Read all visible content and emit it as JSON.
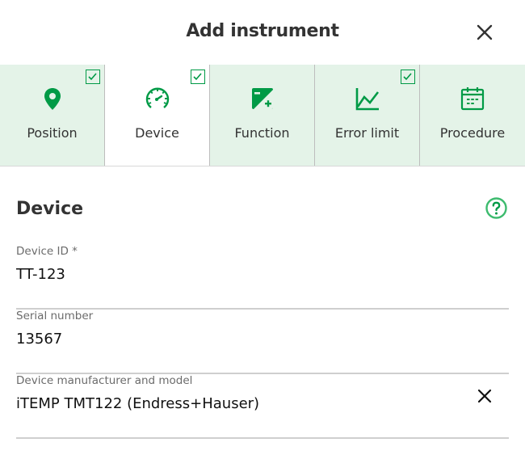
{
  "dialog": {
    "title": "Add instrument",
    "close_icon": "close-icon"
  },
  "steps": [
    {
      "label": "Position",
      "icon": "map-pin-icon",
      "checked": true,
      "active": false
    },
    {
      "label": "Device",
      "icon": "gauge-icon",
      "checked": true,
      "active": true
    },
    {
      "label": "Function",
      "icon": "function-icon",
      "checked": false,
      "active": false
    },
    {
      "label": "Error limit",
      "icon": "line-chart-icon",
      "checked": true,
      "active": false
    },
    {
      "label": "Procedure",
      "icon": "calendar-icon",
      "checked": false,
      "active": false
    }
  ],
  "section": {
    "title": "Device",
    "help_icon": "help-icon"
  },
  "fields": [
    {
      "label": "Device ID *",
      "value": "TT-123"
    },
    {
      "label": "Serial number",
      "value": "13567"
    },
    {
      "label": "Device manufacturer and model",
      "value": "iTEMP TMT122 (Endress+Hauser)",
      "clearable": true
    }
  ],
  "colors": {
    "accent": "#009a46",
    "step_bg": "#e4f3e8",
    "help": "#3dbb6e"
  }
}
